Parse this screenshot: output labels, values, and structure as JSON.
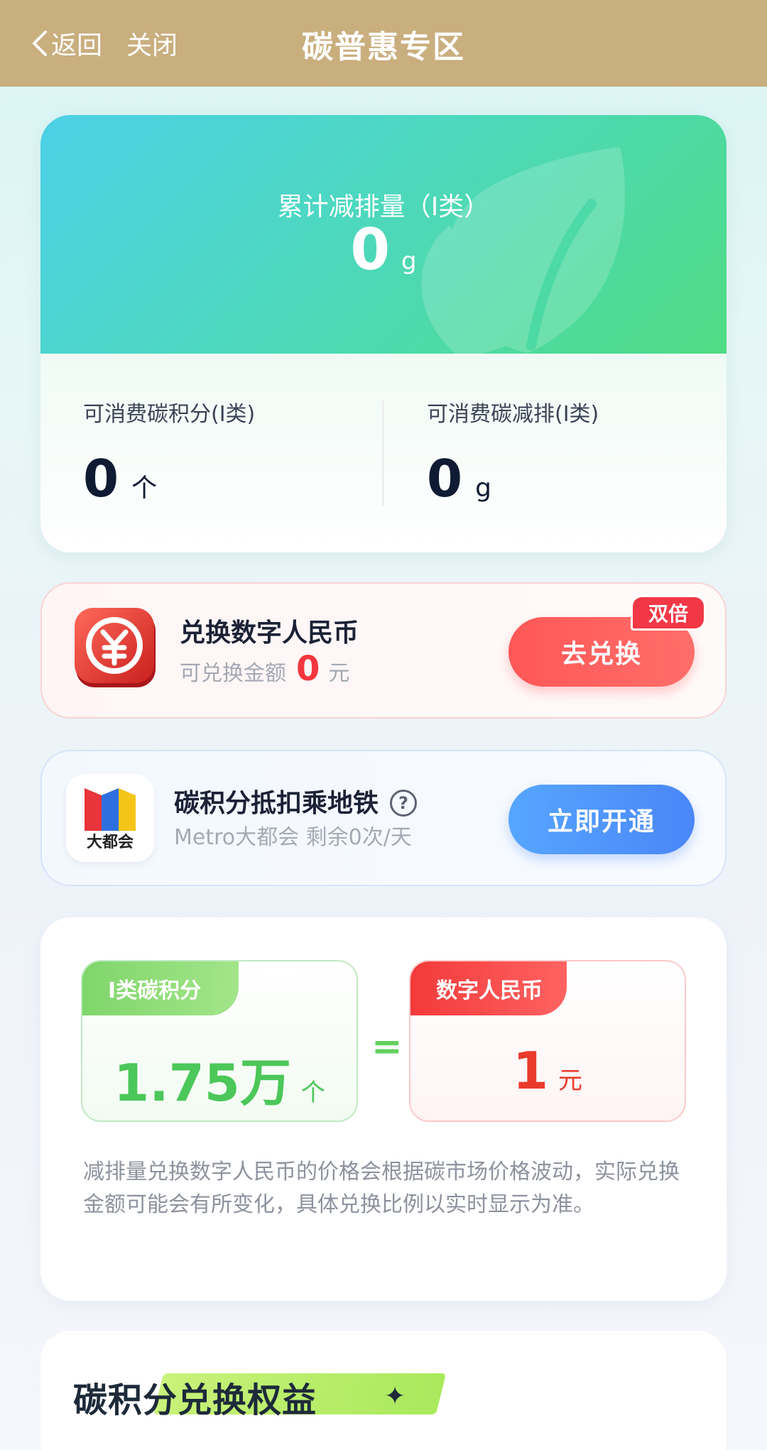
{
  "nav": {
    "back_label": "返回",
    "close_label": "关闭",
    "title": "碳普惠专区"
  },
  "stats": {
    "total_label": "累计减排量（I类）",
    "total_value": "0",
    "total_unit": "g",
    "points_label": "可消费碳积分(I类)",
    "points_value": "0",
    "points_unit": "个",
    "reduction_label": "可消费碳减排(I类)",
    "reduction_value": "0",
    "reduction_unit": "g"
  },
  "exchange": {
    "title": "兑换数字人民币",
    "amount_label": "可兑换金额",
    "amount_value": "0",
    "amount_unit": "元",
    "badge": "双倍",
    "button": "去兑换"
  },
  "metro": {
    "logo_text": "大都会",
    "title": "碳积分抵扣乘地铁",
    "help": "?",
    "subtitle": "Metro大都会 剩余0次/天",
    "button": "立即开通"
  },
  "rate": {
    "left_tag": "I类碳积分",
    "left_value": "1.75万",
    "left_unit": "个",
    "equals": "=",
    "right_tag": "数字人民币",
    "right_value": "1",
    "right_unit": "元",
    "note": "减排量兑换数字人民币的价格会根据碳市场价格波动，实际兑换金额可能会有所变化，具体兑换比例以实时显示为准。"
  },
  "benefits": {
    "title": "碳积分兑换权益"
  },
  "colors": {
    "nav_bg": "#c9ae7e",
    "accent_green": "#4cc75a",
    "accent_red": "#f3363f",
    "accent_blue": "#4a86f7"
  }
}
